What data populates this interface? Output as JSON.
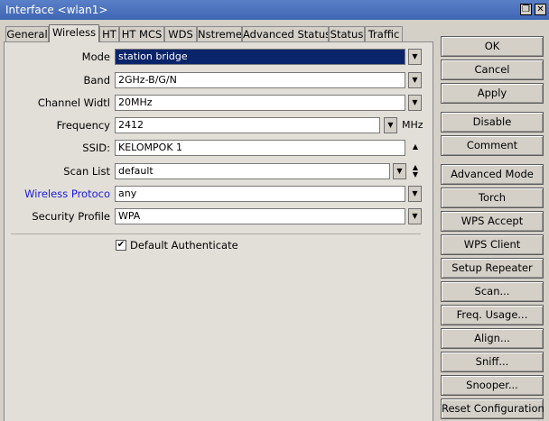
{
  "window": {
    "title": "Interface <wlan1>",
    "restore_glyph": "❐",
    "close_glyph": "✕"
  },
  "tabs": [
    {
      "label": "General"
    },
    {
      "label": "Wireless"
    },
    {
      "label": "HT"
    },
    {
      "label": "HT MCS"
    },
    {
      "label": "WDS"
    },
    {
      "label": "Nstreme"
    },
    {
      "label": "Advanced Status"
    },
    {
      "label": "Status"
    },
    {
      "label": "Traffic"
    }
  ],
  "form": {
    "mode": {
      "label": "Mode",
      "value": "station bridge"
    },
    "band": {
      "label": "Band",
      "value": "2GHz-B/G/N"
    },
    "channel_width": {
      "label": "Channel Widtl",
      "value": "20MHz"
    },
    "frequency": {
      "label": "Frequency",
      "value": "2412",
      "unit": "MHz"
    },
    "ssid": {
      "label": "SSID:",
      "value": "KELOMPOK 1"
    },
    "scan_list": {
      "label": "Scan List",
      "value": "default"
    },
    "wireless_protocol": {
      "label": "Wireless Protoco",
      "value": "any"
    },
    "security_profile": {
      "label": "Security Profile",
      "value": "WPA"
    },
    "default_authenticate": {
      "label": "Default Authenticate",
      "checked": true
    }
  },
  "buttons": {
    "ok": "OK",
    "cancel": "Cancel",
    "apply": "Apply",
    "disable": "Disable",
    "comment": "Comment",
    "advanced_mode": "Advanced Mode",
    "torch": "Torch",
    "wps_accept": "WPS Accept",
    "wps_client": "WPS Client",
    "setup_repeater": "Setup Repeater",
    "scan": "Scan...",
    "freq_usage": "Freq. Usage...",
    "align": "Align...",
    "sniff": "Sniff...",
    "snooper": "Snooper...",
    "reset_configuration": "Reset Configuration"
  },
  "colors": {
    "titlebar": "#3f66b4",
    "selection": "#0a246a",
    "link_label": "#1a1adc"
  }
}
